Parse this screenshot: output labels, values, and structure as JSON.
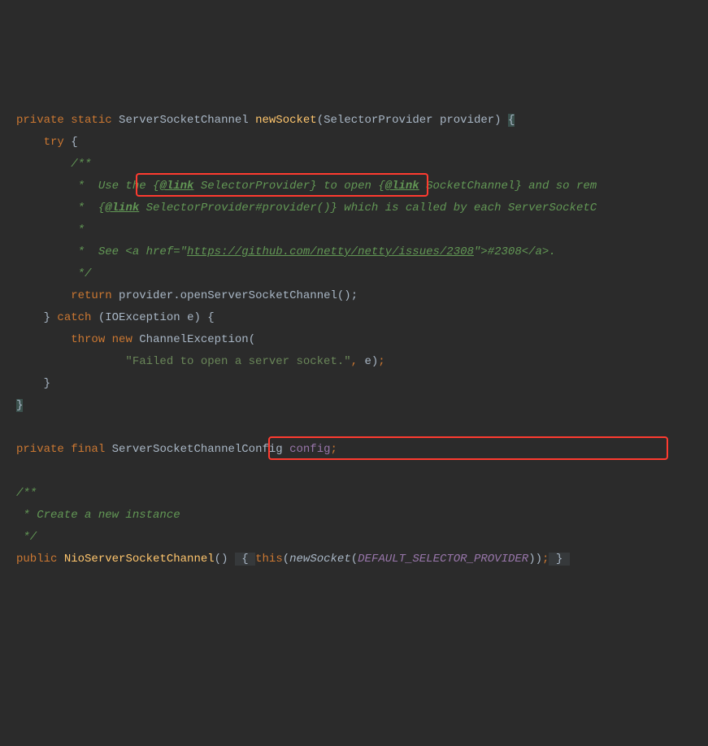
{
  "code": {
    "l1_kw1": "private",
    "l1_kw2": "static",
    "l1_type": "ServerSocketChannel",
    "l1_method": "newSocket",
    "l1_ptype": "SelectorProvider",
    "l1_pname": "provider",
    "l2_try": "try",
    "l3_c": "/**",
    "l4_c1": " *  Use the {",
    "l4_tag": "@link",
    "l4_c2": " SelectorProvider}",
    "l4_c3": " to open {",
    "l4_tag2": "@link",
    "l4_c4": " SocketChannel}",
    "l4_c5": " and so rem",
    "l5_c1": " *  {",
    "l5_tag": "@link",
    "l5_c2": " SelectorProvider#provider()}",
    "l5_c3": " which is called by each ServerSocketC",
    "l6_c": " *",
    "l7_c1": " *  See <a href=\"",
    "l7_url": "https://github.com/netty/netty/issues/2308",
    "l7_c2": "\">#2308</a>.",
    "l8_c": " */",
    "l9_ret": "return",
    "l9_expr1": "provider.",
    "l9_expr2": "openServerSocketChannel",
    "l9_expr3": "();",
    "l10_catch": "catch",
    "l10_ex": "IOException",
    "l10_var": "e",
    "l11_throw": "throw",
    "l11_new": "new",
    "l11_type": "ChannelException",
    "l12_str": "\"Failed to open a server socket.\"",
    "l12_var": "e",
    "l16_kw1": "private",
    "l16_kw2": "final",
    "l16_type": "ServerSocketChannelConfig",
    "l16_field": "config",
    "l18_c": "/**",
    "l19_c": " * Create a new instance",
    "l20_c": " */",
    "l21_kw": "public",
    "l21_ctor": "NioServerSocketChannel",
    "l21_this": "this",
    "l21_call": "newSocket",
    "l21_const": "DEFAULT_SELECTOR_PROVIDER"
  }
}
